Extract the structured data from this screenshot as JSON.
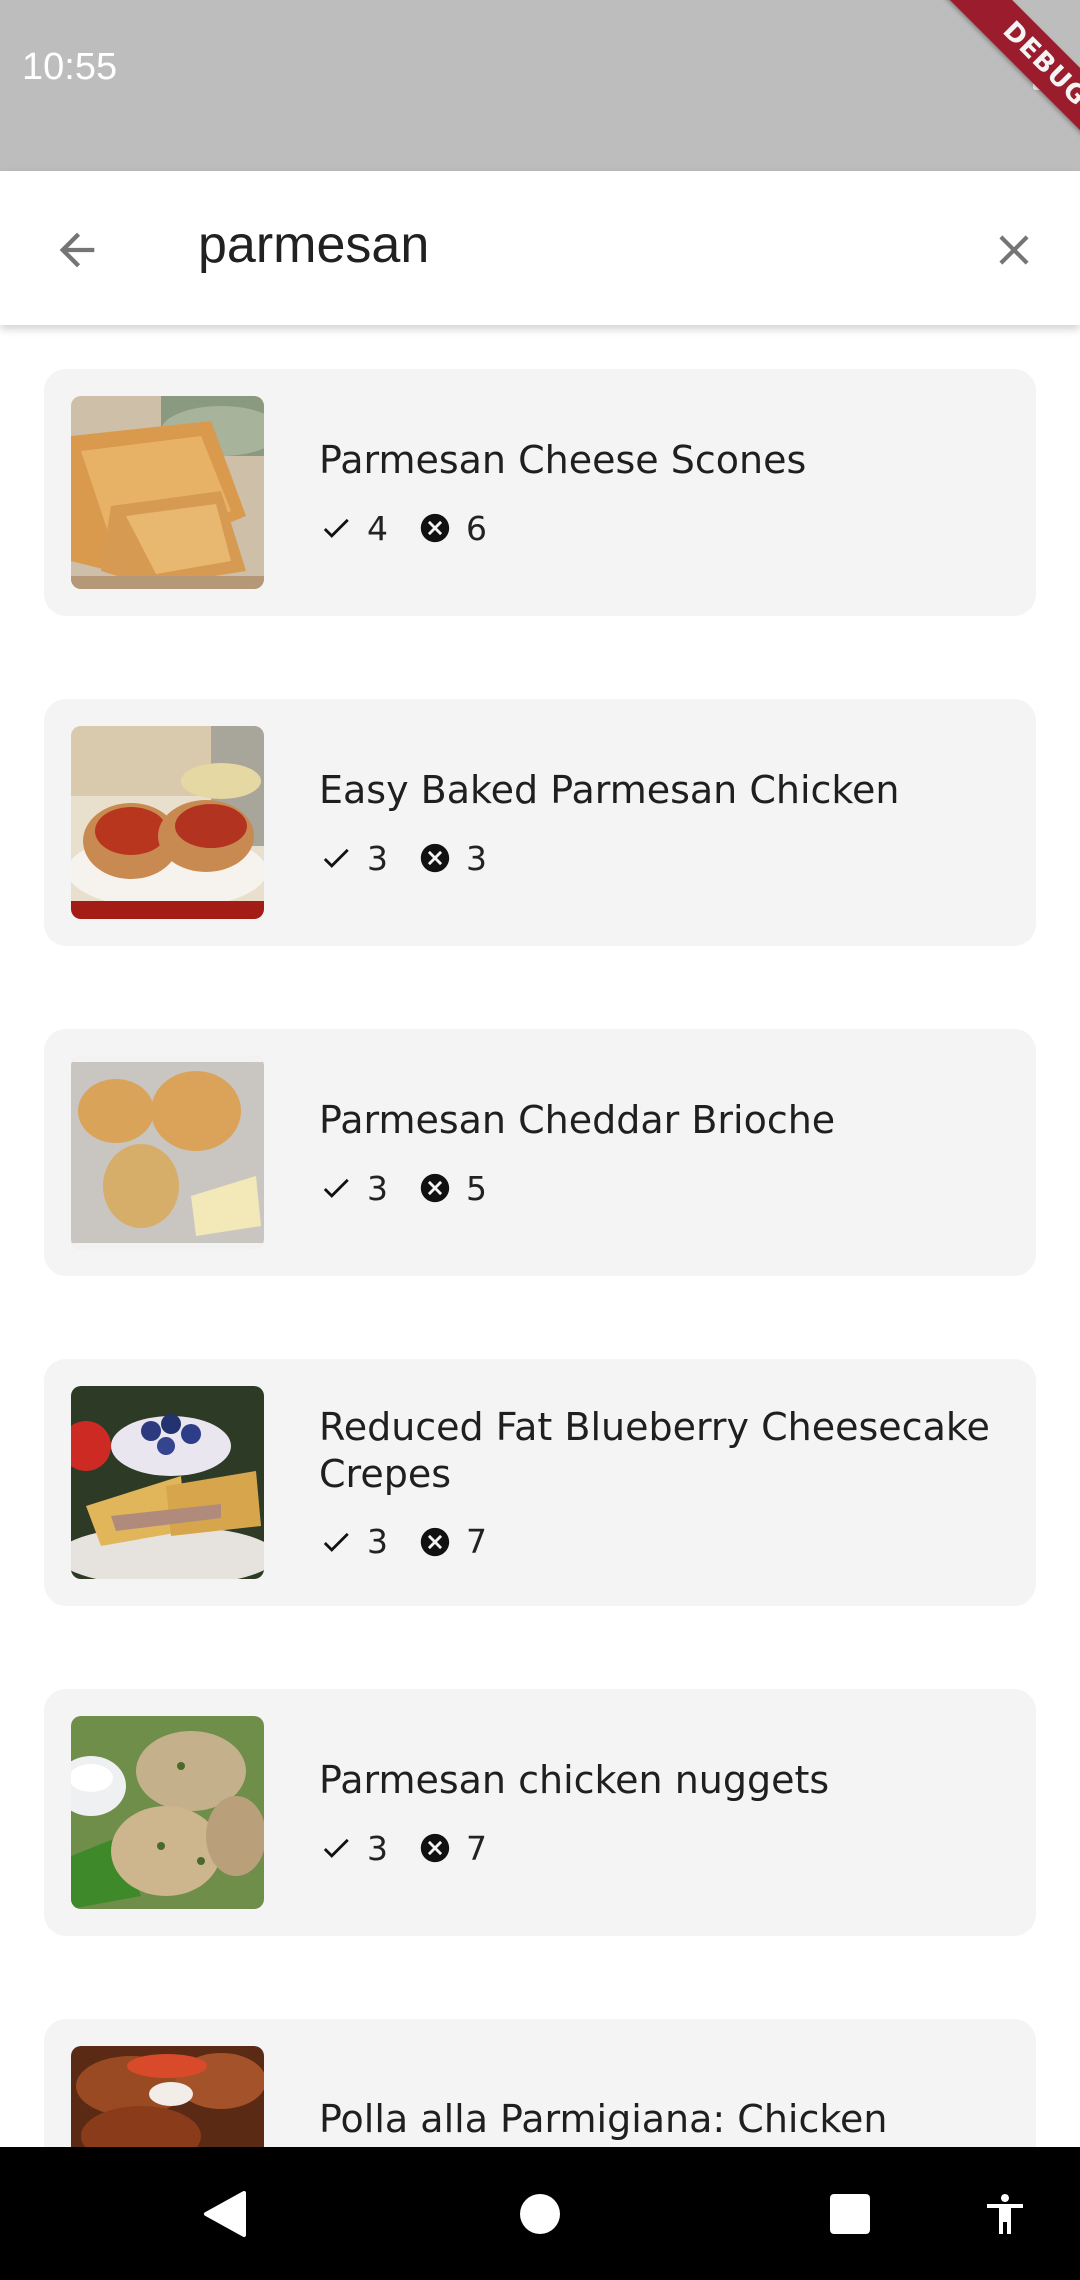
{
  "status_bar": {
    "time": "10:55",
    "debug_label": "DEBUG"
  },
  "search": {
    "query": "parmesan"
  },
  "results": [
    {
      "title": "Parmesan Cheese Scones",
      "matched": "4",
      "missing": "6"
    },
    {
      "title": "Easy Baked Parmesan Chicken",
      "matched": "3",
      "missing": "3"
    },
    {
      "title": "Parmesan Cheddar Brioche",
      "matched": "3",
      "missing": "5"
    },
    {
      "title": "Reduced Fat Blueberry Cheesecake Crepes",
      "matched": "3",
      "missing": "7"
    },
    {
      "title": "Parmesan chicken nuggets",
      "matched": "3",
      "missing": "7"
    },
    {
      "title": "Polla alla Parmigiana: Chicken Parmesan"
    }
  ],
  "icons": {
    "back": "arrow-back-icon",
    "clear": "close-icon",
    "matched": "check-icon",
    "missing": "cancel-circle-icon",
    "nav_back": "triangle-back-icon",
    "nav_home": "circle-home-icon",
    "nav_recents": "square-recents-icon",
    "accessibility": "accessibility-icon"
  },
  "colors": {
    "status_bar": "#bdbdbd",
    "card_bg": "#f4f4f4",
    "debug_banner": "#9b1c2c"
  }
}
